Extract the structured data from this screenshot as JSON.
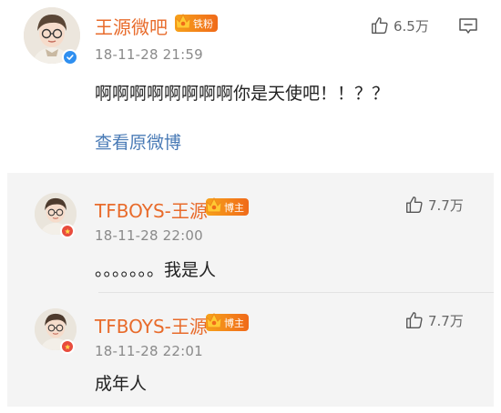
{
  "main_post": {
    "author": "王源微吧",
    "badge": "铁粉",
    "time": "18-11-28 21:59",
    "text": "啊啊啊啊啊啊啊啊你是天使吧！！？？",
    "link": "查看原微博",
    "likes": "6.5万"
  },
  "replies": [
    {
      "author": "TFBOYS-王源",
      "badge": "博主",
      "time": "18-11-28 22:00",
      "text": "。。。。。。。我是人",
      "likes": "7.7万"
    },
    {
      "author": "TFBOYS-王源",
      "badge": "博主",
      "time": "18-11-28 22:01",
      "text": "成年人",
      "likes": "7.7万"
    }
  ],
  "colors": {
    "name": "#e86b2b",
    "link": "#4a7bb6",
    "badge_start": "#f7a21a",
    "badge_end": "#f06a1a",
    "verify_blue": "#2f8ff0",
    "verify_red": "#e84c3d",
    "reply_bg": "#f4f4f4"
  }
}
